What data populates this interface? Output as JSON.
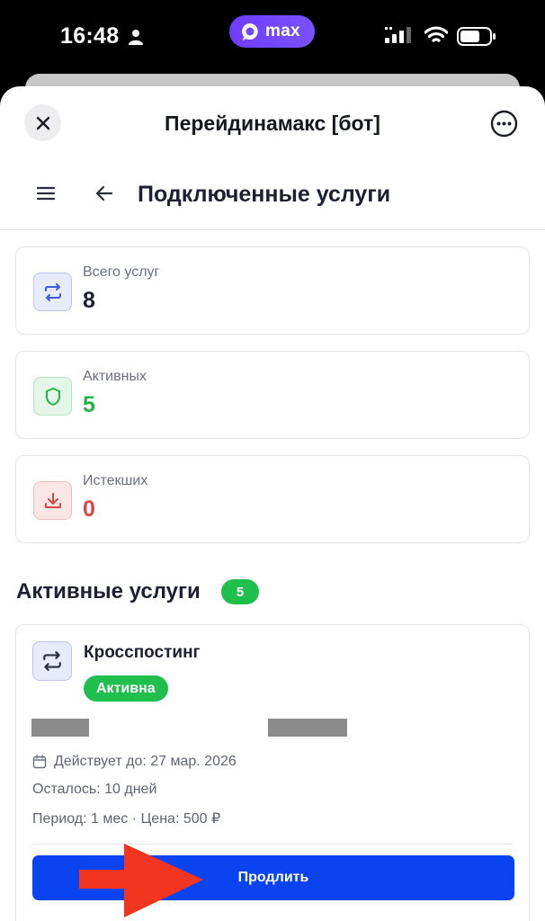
{
  "status_bar": {
    "time": "16:48",
    "app_pill": "max"
  },
  "header": {
    "title": "Перейдинамакс [бот]"
  },
  "nav": {
    "title": "Подключенные услуги"
  },
  "stats": [
    {
      "label": "Всего услуг",
      "value": "8",
      "value_color": "#1c2030",
      "icon": "repeat-icon"
    },
    {
      "label": "Активных",
      "value": "5",
      "value_color": "#22b447",
      "icon": "shield-icon"
    },
    {
      "label": "Истекших",
      "value": "0",
      "value_color": "#d54848",
      "icon": "download-icon"
    }
  ],
  "section": {
    "title": "Активные услуги",
    "count": "5"
  },
  "service": {
    "name": "Кросспостинг",
    "status": "Активна",
    "valid_until": "Действует до: 27 мар. 2026",
    "remaining": "Осталось: 10 дней",
    "period_price": "Период: 1 мес · Цена: 500 ₽",
    "action": "Продлить"
  },
  "colors": {
    "accent_blue": "#0a44f0",
    "success_green": "#1fbf4d",
    "danger_red": "#d54848",
    "annotation_arrow": "#f2351f"
  }
}
